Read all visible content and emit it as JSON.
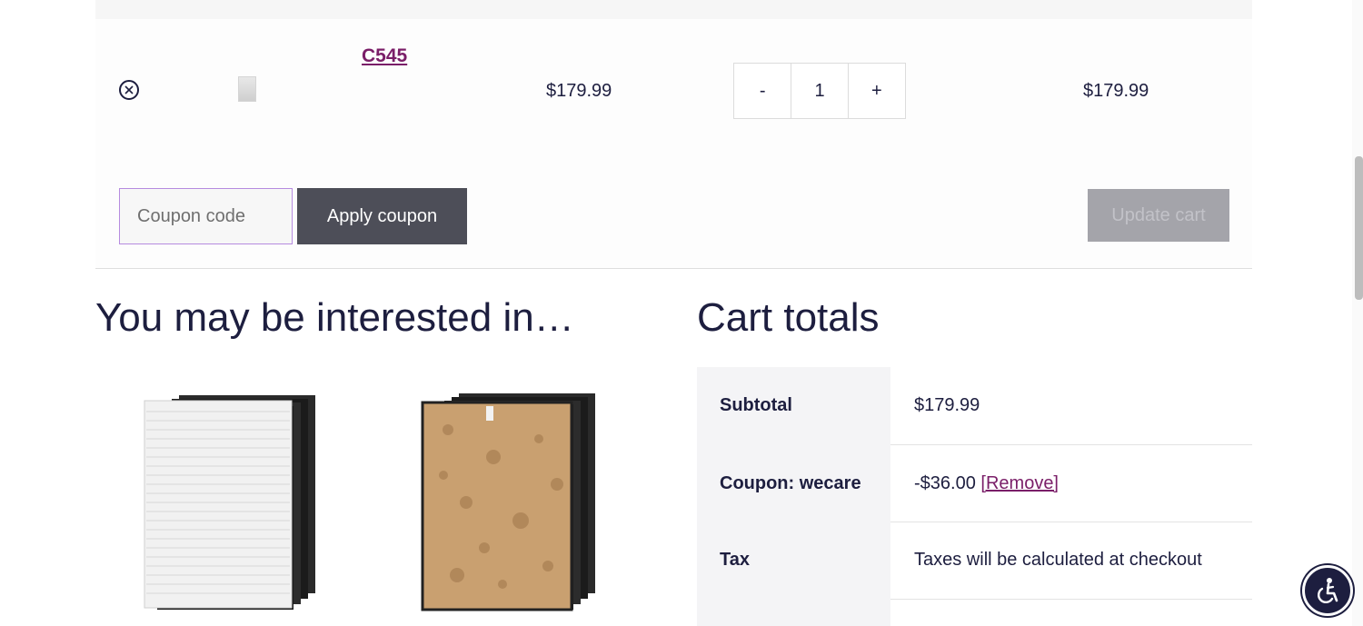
{
  "cart_item": {
    "remove_icon": "circle-x-icon",
    "name": "C545",
    "price": "$179.99",
    "quantity": "1",
    "qty_minus": "-",
    "qty_plus": "+",
    "subtotal": "$179.99"
  },
  "actions": {
    "coupon_placeholder": "Coupon code",
    "apply_label": "Apply coupon",
    "update_label": "Update cart"
  },
  "cross_sells": {
    "heading": "You may be interested in…",
    "products": [
      {
        "image": "white-hepa-filter-image"
      },
      {
        "image": "carbon-prefilter-image"
      }
    ]
  },
  "totals": {
    "heading": "Cart totals",
    "rows": [
      {
        "label": "Subtotal",
        "value": "$179.99"
      },
      {
        "label": "Coupon: wecare",
        "value": "-$36.00",
        "link": "[Remove]"
      },
      {
        "label": "Tax",
        "value": "Taxes will be calculated at checkout"
      }
    ]
  },
  "accessibility_icon": "accessibility-icon",
  "colors": {
    "text": "#1d1e3f",
    "link": "#7a1e68",
    "button_dark": "#4d4e58",
    "button_disabled": "#a4a4aa",
    "coupon_border": "#b68be0"
  }
}
